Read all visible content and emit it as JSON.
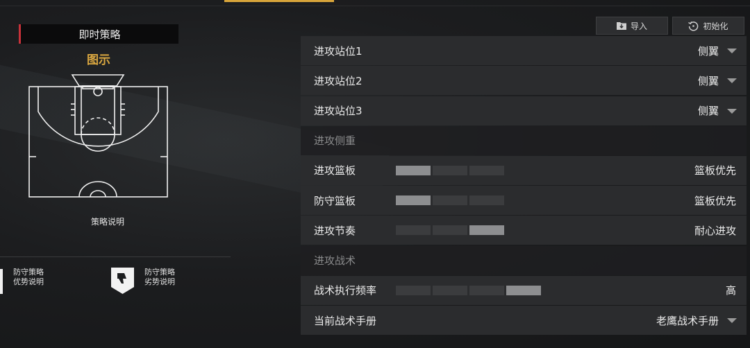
{
  "left": {
    "strategy_title": "即时策略",
    "diagram_label": "图示",
    "strategy_explain": "策略说明",
    "advantage": {
      "line1": "防守策略",
      "line2": "优势说明"
    },
    "disadvantage": {
      "line1": "防守策略",
      "line2": "劣势说明"
    }
  },
  "toolbar": {
    "import_label": "导入",
    "init_label": "初始化"
  },
  "settings": {
    "attack_pos1": {
      "label": "进攻站位1",
      "value": "侧翼"
    },
    "attack_pos2": {
      "label": "进攻站位2",
      "value": "侧翼"
    },
    "attack_pos3": {
      "label": "进攻站位3",
      "value": "侧翼"
    },
    "section_focus": "进攻侧重",
    "off_rebound": {
      "label": "进攻篮板",
      "value": "篮板优先",
      "level": 1,
      "max": 3
    },
    "def_rebound": {
      "label": "防守篮板",
      "value": "篮板优先",
      "level": 1,
      "max": 3
    },
    "tempo": {
      "label": "进攻节奏",
      "value": "耐心进攻",
      "level": 3,
      "max": 3
    },
    "section_tactics": "进攻战术",
    "tactic_freq": {
      "label": "战术执行频率",
      "value": "高",
      "level": 4,
      "max": 4
    },
    "playbook": {
      "label": "当前战术手册",
      "value": "老鹰战术手册"
    }
  },
  "colors": {
    "accent": "#d7a43a",
    "diagram_label": "#d9a640",
    "red_marker": "#c8323a"
  }
}
